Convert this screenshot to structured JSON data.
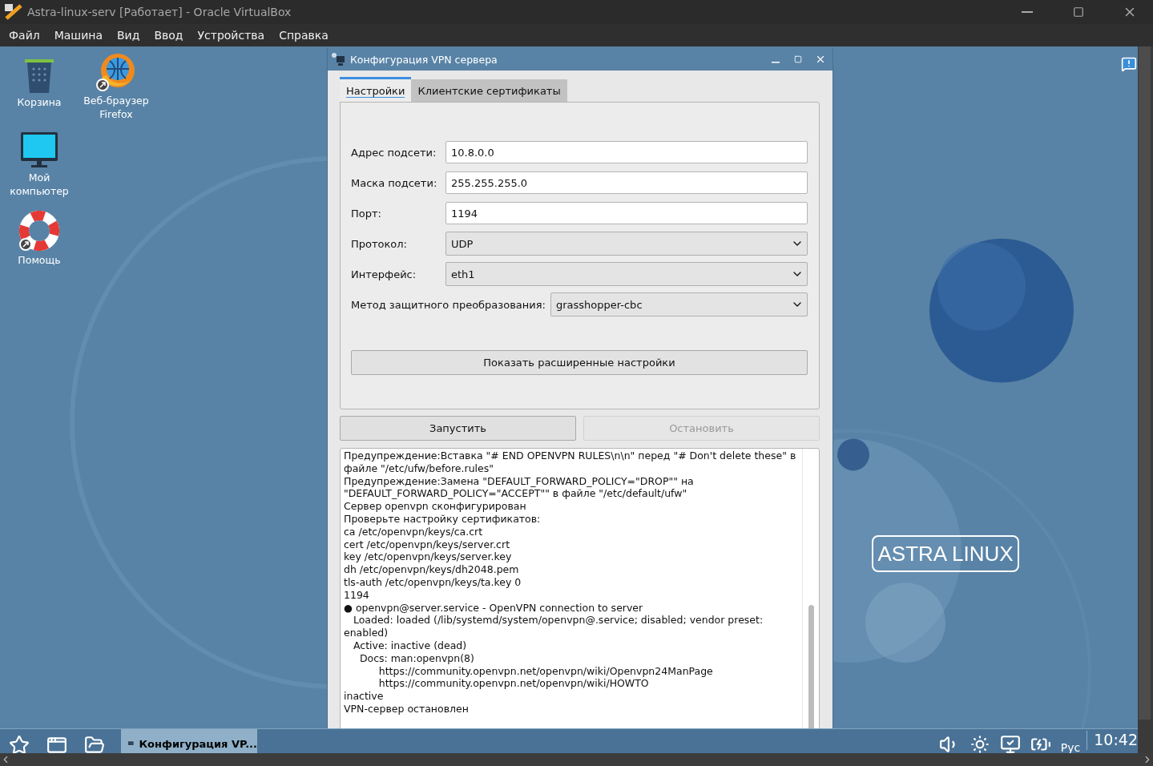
{
  "app_window": {
    "title": "Astra-linux-serv [Работает] - Oracle VirtualBox"
  },
  "menu": [
    "Файл",
    "Машина",
    "Вид",
    "Ввод",
    "Устройства",
    "Справка"
  ],
  "desktop_icons": [
    {
      "label": "Корзина",
      "kind": "trash"
    },
    {
      "label": "Веб-браузер Firefox",
      "kind": "browser"
    },
    {
      "label": "Мой компьютер",
      "kind": "computer"
    },
    {
      "label": "Помощь",
      "kind": "help"
    }
  ],
  "logo": "ASTRA LINUX",
  "dialog": {
    "title": "Конфигурация VPN сервера",
    "tabs": [
      {
        "label": "Настройки",
        "selected": true
      },
      {
        "label": "Клиентские сертификаты",
        "selected": false
      }
    ],
    "fields": [
      {
        "label": "Адрес подсети:",
        "value": "10.8.0.0",
        "kind": "text"
      },
      {
        "label": "Маска подсети:",
        "value": "255.255.255.0",
        "kind": "text"
      },
      {
        "label": "Порт:",
        "value": "1194",
        "kind": "text"
      },
      {
        "label": "Протокол:",
        "value": "UDP",
        "kind": "select"
      },
      {
        "label": "Интерфейс:",
        "value": "eth1",
        "kind": "select"
      },
      {
        "label": "Метод защитного преобразования:",
        "value": "grasshopper-cbc",
        "kind": "select"
      }
    ],
    "advanced_button": "Показать расширенные настройки",
    "buttons": [
      {
        "label": "Запустить",
        "disabled": false
      },
      {
        "label": "Остановить",
        "disabled": true
      }
    ],
    "log": [
      "Предупреждение:Вставка \"# END OPENVPN RULES\\n\\n\" перед \"# Don't delete these\" в файле \"/etc/ufw/before.rules\"",
      "Предупреждение:Замена \"DEFAULT_FORWARD_POLICY=\"DROP\"\" на \"DEFAULT_FORWARD_POLICY=\"ACCEPT\"\" в файле \"/etc/default/ufw\"",
      "Сервер openvpn сконфигурирован",
      "Проверьте настройку сертификатов:",
      "ca /etc/openvpn/keys/ca.crt",
      "cert /etc/openvpn/keys/server.crt",
      "key /etc/openvpn/keys/server.key",
      "dh /etc/openvpn/keys/dh2048.pem",
      "tls-auth /etc/openvpn/keys/ta.key 0",
      "1194",
      "● openvpn@server.service - OpenVPN connection to server",
      "   Loaded: loaded (/lib/systemd/system/openvpn@.service; disabled; vendor preset: enabled)",
      "   Active: inactive (dead)",
      "     Docs: man:openvpn(8)",
      "           https://community.openvpn.net/openvpn/wiki/Openvpn24ManPage",
      "           https://community.openvpn.net/openvpn/wiki/HOWTO",
      "inactive",
      "VPN-сервер остановлен"
    ]
  },
  "taskbar": {
    "task": "Конфигурация VP...",
    "language": "Рус",
    "clock": "10:42"
  }
}
